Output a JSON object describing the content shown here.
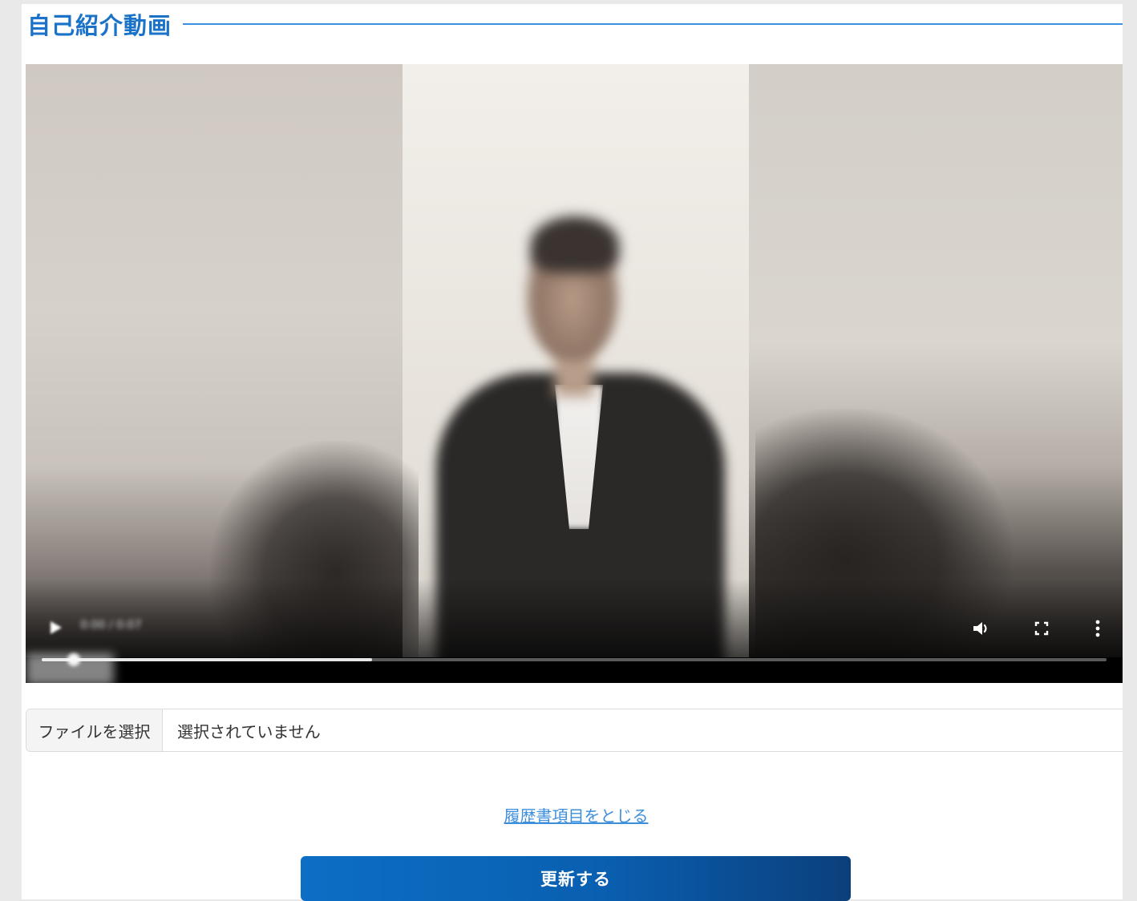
{
  "section": {
    "title": "自己紹介動画"
  },
  "video": {
    "time_display": "0:00 / 0:07",
    "progress_fraction": 0.31,
    "icons": {
      "play": "play-icon",
      "volume": "volume-icon",
      "fullscreen": "fullscreen-icon",
      "more": "more-vertical-icon"
    }
  },
  "file_input": {
    "button_label": "ファイルを選択",
    "status_text": "選択されていません"
  },
  "links": {
    "close_resume": "履歴書項目をとじる"
  },
  "actions": {
    "update_label": "更新する"
  },
  "colors": {
    "heading": "#1a73c8",
    "link": "#3d8fdc",
    "button_start": "#0c6ec4",
    "button_end": "#0b3f7c"
  }
}
